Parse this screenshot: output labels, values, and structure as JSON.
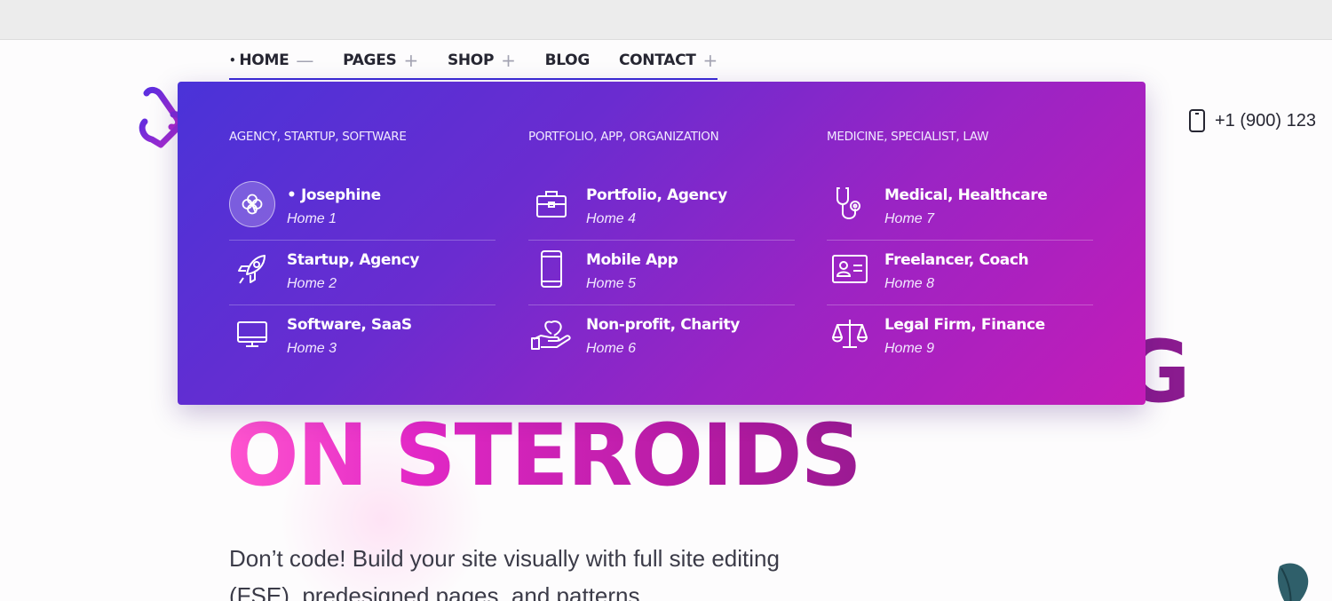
{
  "nav": {
    "items": [
      {
        "label": "HOME",
        "sign": "—",
        "active": true,
        "dot": "•"
      },
      {
        "label": "PAGES",
        "sign": "+"
      },
      {
        "label": "SHOP",
        "sign": "+"
      },
      {
        "label": "BLOG",
        "sign": ""
      },
      {
        "label": "CONTACT",
        "sign": "+"
      }
    ]
  },
  "header": {
    "phone": "+1 (900) 123",
    "phone_icon": "mobile-phone-icon",
    "logo_icon": "heart-link-logo"
  },
  "megamenu": {
    "columns": [
      {
        "heading": "AGENCY, STARTUP, SOFTWARE",
        "entries": [
          {
            "title": "• Josephine",
            "subtitle": "Home 1",
            "icon": "clover-icon",
            "active": true
          },
          {
            "title": "Startup, Agency",
            "subtitle": "Home 2",
            "icon": "rocket-icon"
          },
          {
            "title": "Software, SaaS",
            "subtitle": "Home 3",
            "icon": "monitor-icon"
          }
        ]
      },
      {
        "heading": "PORTFOLIO, APP, ORGANIZATION",
        "entries": [
          {
            "title": "Portfolio, Agency",
            "subtitle": "Home 4",
            "icon": "briefcase-icon"
          },
          {
            "title": "Mobile App",
            "subtitle": "Home 5",
            "icon": "smartphone-icon"
          },
          {
            "title": "Non-profit, Charity",
            "subtitle": "Home 6",
            "icon": "heart-hand-icon"
          }
        ]
      },
      {
        "heading": "MEDICINE, SPECIALIST, LAW",
        "entries": [
          {
            "title": "Medical, Healthcare",
            "subtitle": "Home 7",
            "icon": "stethoscope-icon"
          },
          {
            "title": "Freelancer, Coach",
            "subtitle": "Home 8",
            "icon": "id-card-icon"
          },
          {
            "title": "Legal Firm, Finance",
            "subtitle": "Home 9",
            "icon": "scales-icon"
          }
        ]
      }
    ]
  },
  "hero": {
    "title": "ON STEROIDS",
    "title_partial": "G",
    "subtitle": "Don’t code! Build your site visually with full site editing (FSE), predesigned pages, and patterns."
  },
  "colors": {
    "accent": "#3b2ad6",
    "menu_gradient_start": "#4a33d8",
    "menu_gradient_end": "#c41cb8",
    "hero_pink": "#e228c6"
  }
}
